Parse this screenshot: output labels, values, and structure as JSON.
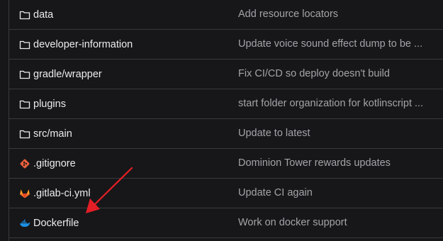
{
  "files": [
    {
      "name": "data",
      "type": "folder",
      "icon": "folder-icon",
      "commit": "Add resource locators"
    },
    {
      "name": "developer-information",
      "type": "folder",
      "icon": "folder-icon",
      "commit": "Update voice sound effect dump to be ..."
    },
    {
      "name": "gradle/wrapper",
      "type": "folder",
      "icon": "folder-icon",
      "commit": "Fix CI/CD so deploy doesn't build"
    },
    {
      "name": "plugins",
      "type": "folder",
      "icon": "folder-icon",
      "commit": "start folder organization for kotlinscript ..."
    },
    {
      "name": "src/main",
      "type": "folder",
      "icon": "folder-icon",
      "commit": "Update to latest"
    },
    {
      "name": ".gitignore",
      "type": "file",
      "icon": "git-icon",
      "commit": "Dominion Tower rewards updates"
    },
    {
      "name": ".gitlab-ci.yml",
      "type": "file",
      "icon": "gitlab-icon",
      "commit": "Update CI again"
    },
    {
      "name": "Dockerfile",
      "type": "file",
      "icon": "docker-icon",
      "commit": "Work on docker support"
    }
  ],
  "colors": {
    "background": "#171719",
    "border": "#3a3a3f",
    "name_text": "#ececef",
    "commit_text": "#a4a3a8",
    "git_orange": "#e8603c",
    "gitlab_orange": "#fc6d26",
    "docker_blue": "#1d91e6",
    "annotation_red": "#e41e26"
  },
  "annotation": {
    "type": "arrow",
    "points_to": "Dockerfile",
    "icon": "red-arrow-icon"
  }
}
